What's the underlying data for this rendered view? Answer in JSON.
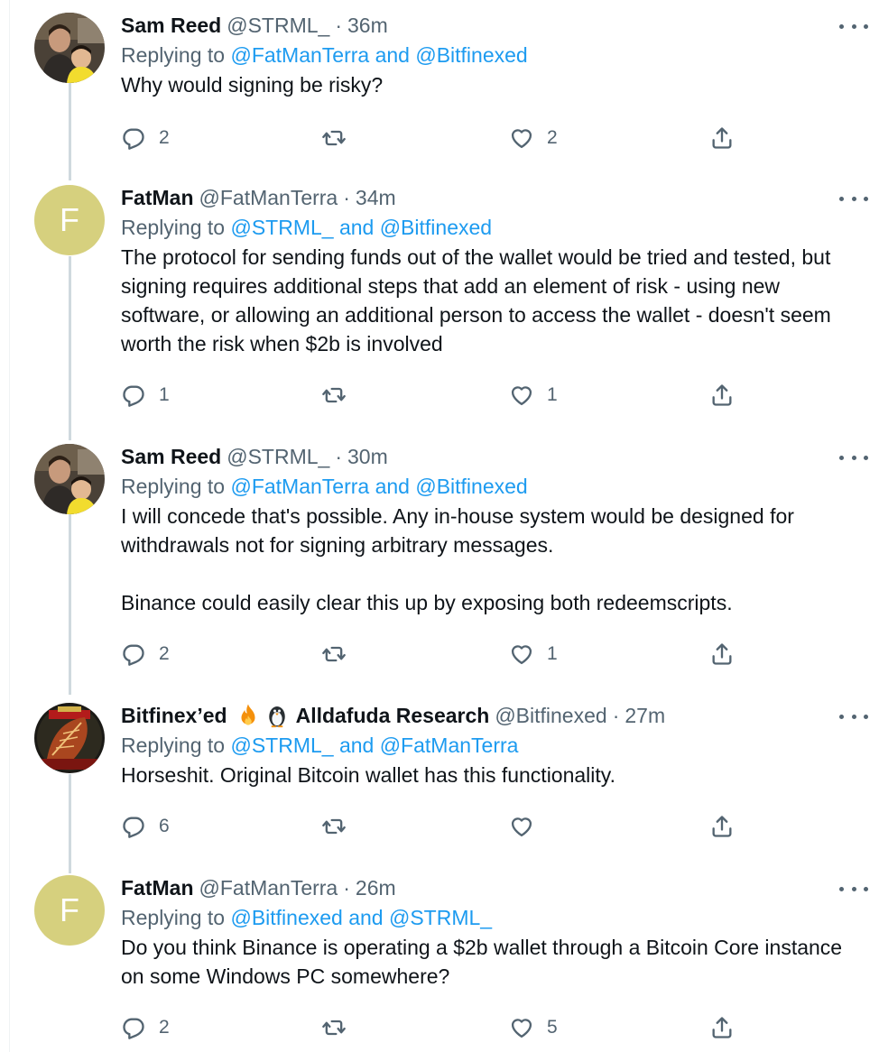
{
  "tweets": [
    {
      "name": "Sam Reed",
      "handle": "@STRML_",
      "time": "36m",
      "replying_prefix": "Replying to ",
      "replying_to": "@FatManTerra and @Bitfinexed",
      "text": [
        "Why would signing be risky?"
      ],
      "replies": "2",
      "retweets": "",
      "likes": "2",
      "avatar": "photo"
    },
    {
      "name": "FatMan",
      "handle": "@FatManTerra",
      "time": "34m",
      "replying_prefix": "Replying to ",
      "replying_to": "@STRML_ and @Bitfinexed",
      "text": [
        "The protocol for sending funds out of the wallet would be tried and tested, but signing requires additional steps that add an element of risk - using new software, or allowing an additional person to access the wallet - doesn't seem worth the risk when $2b is involved"
      ],
      "replies": "1",
      "retweets": "",
      "likes": "1",
      "avatar": "F"
    },
    {
      "name": "Sam Reed",
      "handle": "@STRML_",
      "time": "30m",
      "replying_prefix": "Replying to ",
      "replying_to": "@FatManTerra and @Bitfinexed",
      "text": [
        "I will concede that's possible. Any in-house system would be designed for withdrawals not for signing arbitrary messages.",
        "Binance could easily clear this up by exposing both redeemscripts."
      ],
      "replies": "2",
      "retweets": "",
      "likes": "1",
      "avatar": "photo"
    },
    {
      "name": "Bitfinex’ed",
      "name_suffix": "Alldafuda Research",
      "handle": "@Bitfinexed",
      "time": "27m",
      "replying_prefix": "Replying to ",
      "replying_to": "@STRML_ and @FatManTerra",
      "text": [
        "Horseshit. Original Bitcoin wallet has this functionality."
      ],
      "replies": "6",
      "retweets": "",
      "likes": "",
      "avatar": "illustration"
    },
    {
      "name": "FatMan",
      "handle": "@FatManTerra",
      "time": "26m",
      "replying_prefix": "Replying to ",
      "replying_to": "@Bitfinexed and @STRML_",
      "text": [
        "Do you think Binance is operating a $2b wallet through a Bitcoin Core instance on some Windows PC somewhere?"
      ],
      "replies": "2",
      "retweets": "",
      "likes": "5",
      "avatar": "F"
    }
  ],
  "icons": {
    "reply": "reply-icon",
    "retweet": "retweet-icon",
    "like": "heart-icon",
    "share": "share-icon",
    "more": "more-icon",
    "emoji_1": "fire-emoji-icon",
    "emoji_2": "penguin-emoji-icon"
  },
  "colors": {
    "text": "#0f1419",
    "secondary": "#536471",
    "link": "#1d9bf0",
    "thread_line": "#cfd9de",
    "fatman_avatar": "#d6d07e"
  }
}
